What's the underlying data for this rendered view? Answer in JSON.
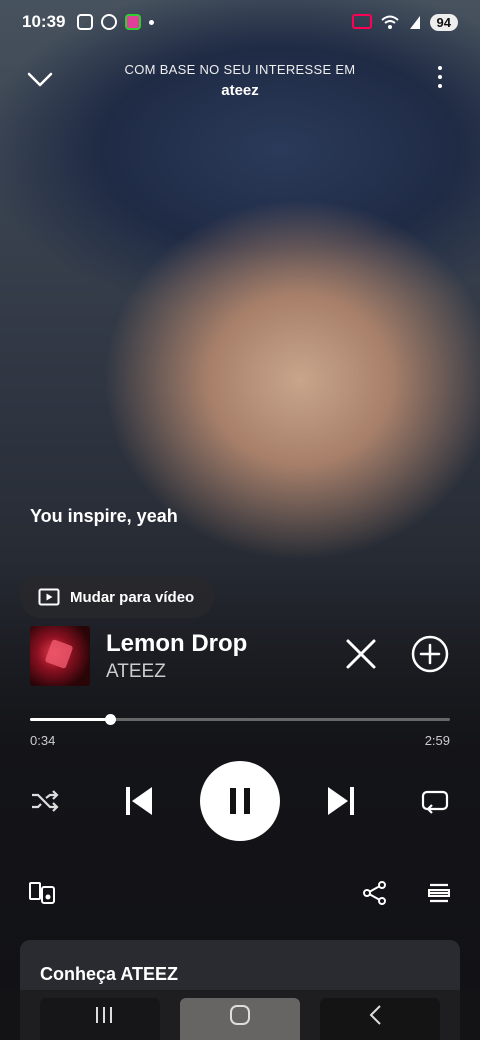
{
  "status_bar": {
    "time": "10:39",
    "battery": "94"
  },
  "header": {
    "caption": "COM BASE NO SEU INTERESSE EM",
    "title": "ateez"
  },
  "lyric": "You inspire, yeah",
  "switch_video_label": "Mudar para vídeo",
  "track": {
    "title": "Lemon Drop",
    "artist": "ATEEZ"
  },
  "playback": {
    "current_time": "0:34",
    "total_time": "2:59",
    "progress_fraction": 0.19,
    "state": "playing"
  },
  "artist_card": {
    "title": "Conheça ATEEZ"
  },
  "icons": {
    "collapse": "chevron-down-icon",
    "menu": "more-vertical-icon",
    "switch_video": "play-square-icon",
    "hide": "close-icon",
    "add": "add-circle-icon",
    "shuffle": "shuffle-icon",
    "previous": "skip-previous-icon",
    "pause": "pause-icon",
    "next": "skip-next-icon",
    "repeat": "repeat-icon",
    "devices": "connect-device-icon",
    "share": "share-icon",
    "queue": "queue-icon"
  },
  "colors": {
    "control_white": "#ffffff",
    "muted_text": "#cccccc",
    "card_bg": "#2a2b30"
  }
}
